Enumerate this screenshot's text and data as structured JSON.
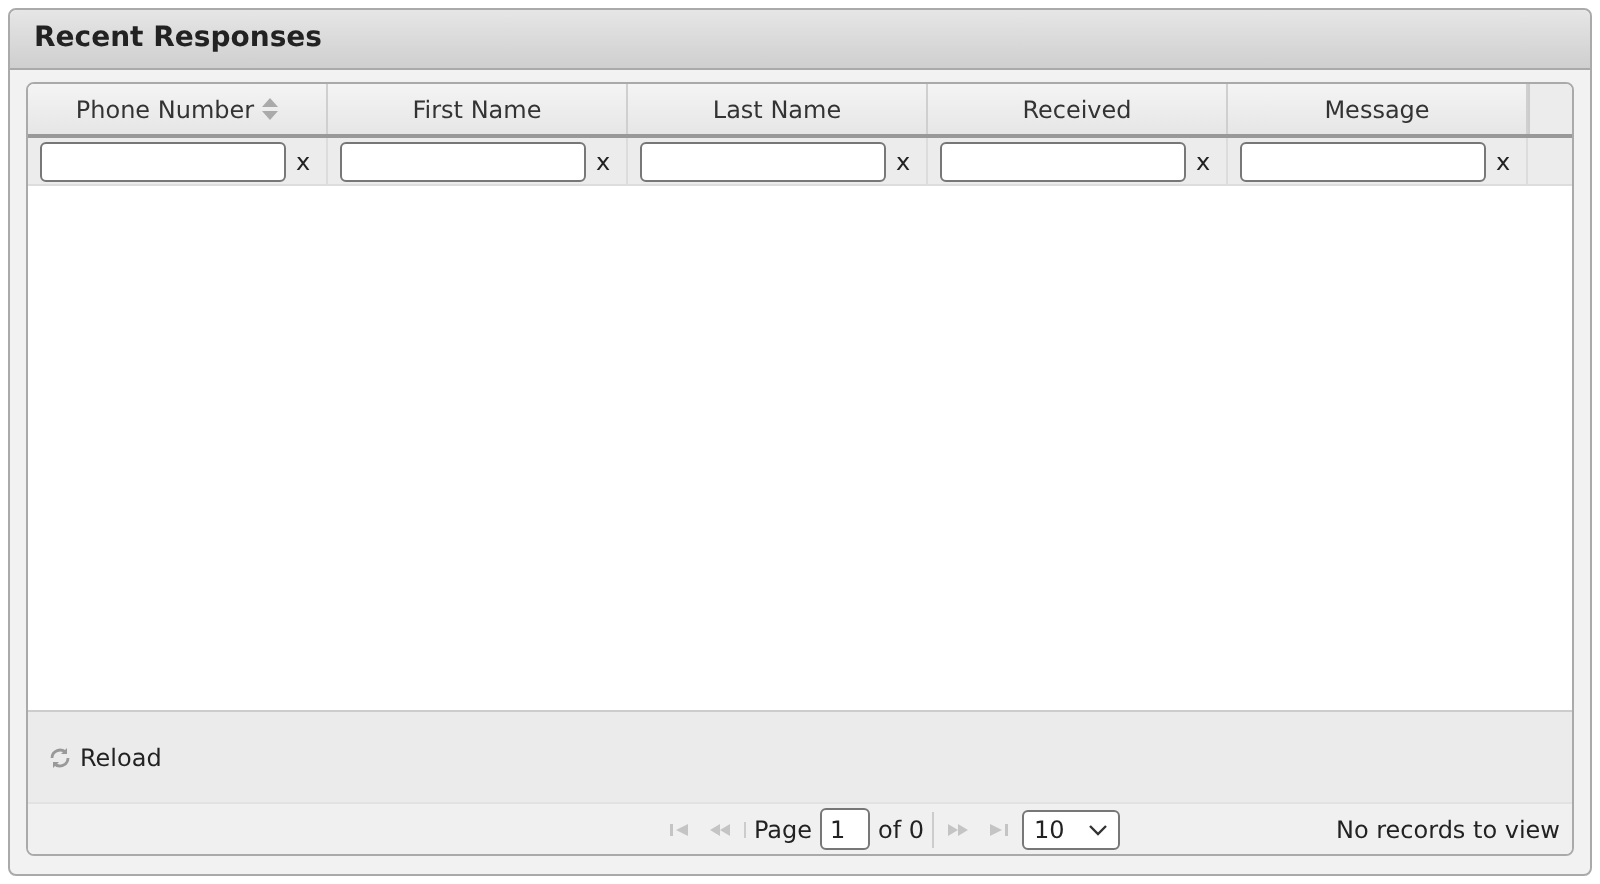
{
  "panel": {
    "title": "Recent Responses"
  },
  "columns": [
    {
      "label": "Phone Number",
      "sortable": true,
      "clear": "x"
    },
    {
      "label": "First Name",
      "sortable": false,
      "clear": "x"
    },
    {
      "label": "Last Name",
      "sortable": false,
      "clear": "x"
    },
    {
      "label": "Received",
      "sortable": false,
      "clear": "x"
    },
    {
      "label": "Message",
      "sortable": false,
      "clear": "x"
    }
  ],
  "toolbar": {
    "reload": "Reload"
  },
  "pager": {
    "nav": [
      {
        "kind": "first",
        "disabled": true
      },
      {
        "kind": "prev",
        "disabled": true
      },
      {
        "kind": "next",
        "disabled": true
      },
      {
        "kind": "last",
        "disabled": true
      }
    ],
    "page_label": "Page",
    "page_value": "1",
    "of_label": "of 0",
    "page_size": "10",
    "records": "No records to view"
  }
}
